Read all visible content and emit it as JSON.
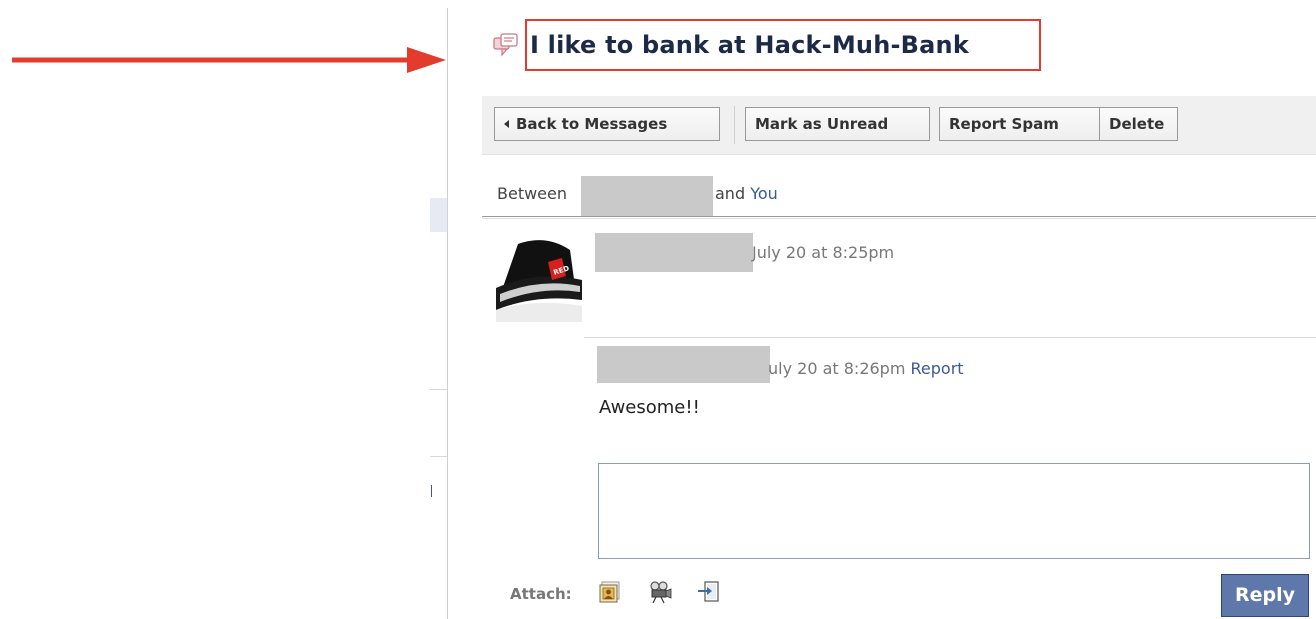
{
  "thread": {
    "title": "I like to bank at Hack-Muh-Bank"
  },
  "toolbar": {
    "back_label": "Back to Messages",
    "unread_label": "Mark as Unread",
    "spam_label": "Report Spam",
    "delete_label": "Delete"
  },
  "participants": {
    "prefix": "Between",
    "joiner": "and",
    "you": "You"
  },
  "messages": [
    {
      "time": "July 20 at 8:25pm",
      "body": ""
    },
    {
      "time": "uly 20 at 8:26pm",
      "report_label": "Report",
      "body": "Awesome!!"
    }
  ],
  "composer": {
    "value": "",
    "attach_label": "Attach:",
    "attach_icons": [
      "photo-icon",
      "video-icon",
      "share-link-icon"
    ],
    "reply_label": "Reply"
  },
  "colors": {
    "annotation_red": "#e33b2e",
    "link_blue": "#3b5998",
    "reply_button": "#5f78ab"
  }
}
